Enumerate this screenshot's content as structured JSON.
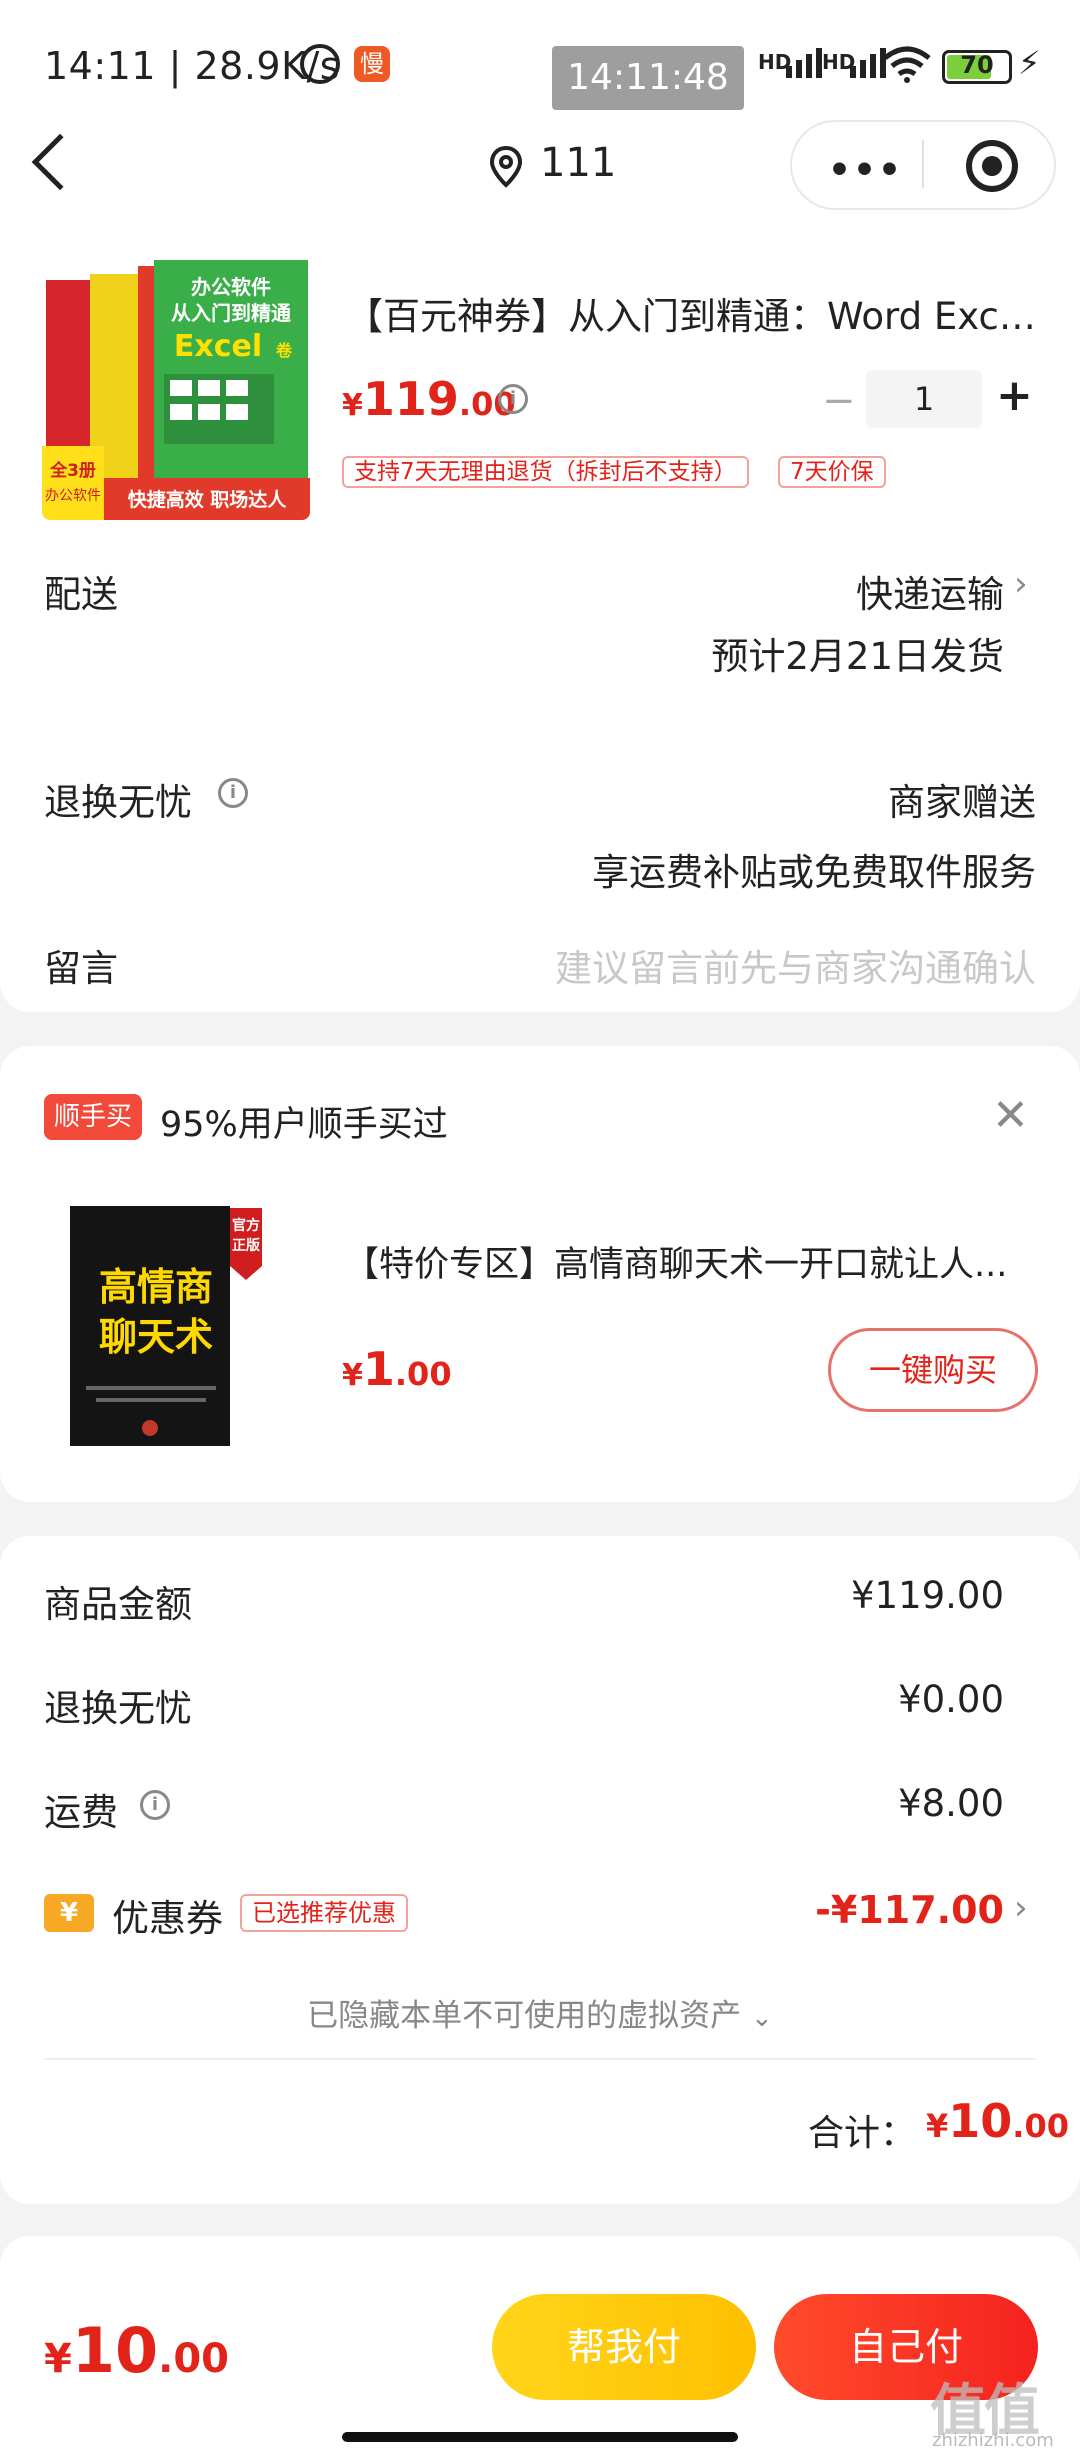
{
  "status_bar": {
    "left_text": "14:11 | 28.9K/s",
    "slow_badge": "慢",
    "time_pill": "14:11:48",
    "hd1": "HD",
    "hd2": "HD",
    "battery": "70"
  },
  "header": {
    "location_text": "111"
  },
  "product": {
    "title": "【百元神券】从入门到精通：Word Excel...",
    "price_symbol": "¥",
    "price_int": "119",
    "price_dec": ".00",
    "quantity": "1",
    "tags": [
      "支持7天无理由退货（拆封后不支持）",
      "7天价保"
    ],
    "cover": {
      "title_line1": "办公软件",
      "title_line2": "从入门到精通",
      "excel": "Excel",
      "suffix": "卷",
      "bottom_left_1": "全3册",
      "bottom_left_2": "办公软件",
      "bottom_right": "快捷高效 职场达人"
    }
  },
  "delivery": {
    "label": "配送",
    "value": "快递运输",
    "estimate": "预计2月21日发货"
  },
  "return": {
    "label": "退换无忧",
    "value": "商家赠送",
    "desc": "享运费补贴或免费取件服务"
  },
  "message": {
    "label": "留言",
    "placeholder": "建议留言前先与商家沟通确认"
  },
  "recommend": {
    "badge": "顺手买",
    "title": "95%用户顺手买过",
    "item_name": "【特价专区】高情商聊天术一开口就让人...",
    "price_symbol": "¥",
    "price_int": "1",
    "price_dec": ".00",
    "buy_label": "一键购买",
    "book_title": "高情商聊天术",
    "book_side": "高情商聊天术",
    "book_ribbon": "官方正版"
  },
  "summary": {
    "goods_label": "商品金额",
    "goods_value": "¥119.00",
    "return_label": "退换无忧",
    "return_value": "¥0.00",
    "shipping_label": "运费",
    "shipping_value": "¥8.00",
    "coupon_icon": "¥",
    "coupon_label": "优惠券",
    "coupon_tag": "已选推荐优惠",
    "coupon_value": "-¥117.00",
    "hidden_assets": "已隐藏本单不可使用的虚拟资产",
    "total_label": "合计：",
    "total_symbol": "¥",
    "total_int": "10",
    "total_dec": ".00"
  },
  "bottom_bar": {
    "price_symbol": "¥",
    "price_int": "10",
    "price_dec": ".00",
    "help_pay": "帮我付",
    "self_pay": "自己付"
  },
  "watermark": {
    "main": "值值值",
    "sub": "zhizhizhi.com"
  }
}
